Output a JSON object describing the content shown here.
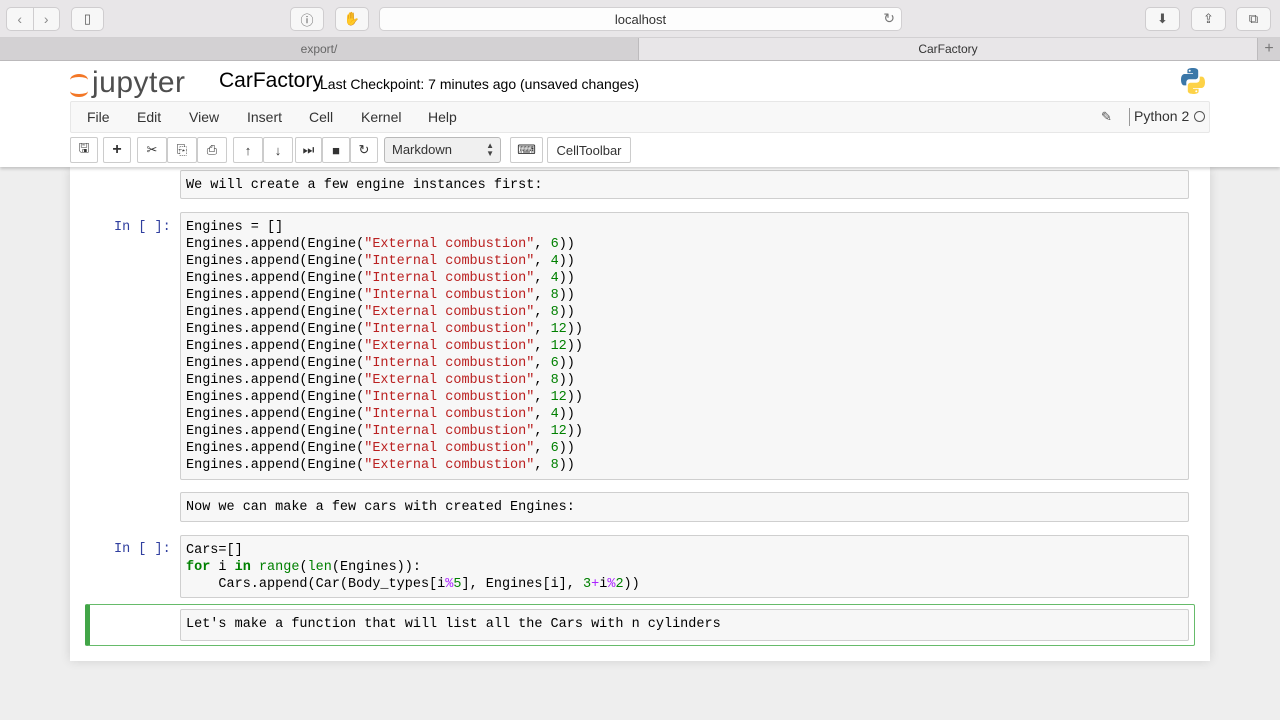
{
  "browser": {
    "url": "localhost",
    "tabs": [
      "export/",
      "CarFactory"
    ],
    "new_tab_label": "+"
  },
  "jupyter": {
    "logo_text": "jupyter",
    "notebook_name": "CarFactory",
    "checkpoint": "Last Checkpoint: 7 minutes ago (unsaved changes)",
    "menu": [
      "File",
      "Edit",
      "View",
      "Insert",
      "Cell",
      "Kernel",
      "Help"
    ],
    "kernel": "Python 2",
    "cell_type": "Markdown",
    "celltoolbar_label": "CellToolbar"
  },
  "cells": {
    "md1": "We will create a few engine instances first:",
    "prompt1": "In [ ]:",
    "engines_init": "Engines = []",
    "engine_calls": [
      {
        "type": "\"External combustion\"",
        "cyl": "6"
      },
      {
        "type": "\"Internal combustion\"",
        "cyl": "4"
      },
      {
        "type": "\"Internal combustion\"",
        "cyl": "4"
      },
      {
        "type": "\"Internal combustion\"",
        "cyl": "8"
      },
      {
        "type": "\"External combustion\"",
        "cyl": "8"
      },
      {
        "type": "\"Internal combustion\"",
        "cyl": "12"
      },
      {
        "type": "\"External combustion\"",
        "cyl": "12"
      },
      {
        "type": "\"Internal combustion\"",
        "cyl": "6"
      },
      {
        "type": "\"External combustion\"",
        "cyl": "8"
      },
      {
        "type": "\"Internal combustion\"",
        "cyl": "12"
      },
      {
        "type": "\"Internal combustion\"",
        "cyl": "4"
      },
      {
        "type": "\"Internal combustion\"",
        "cyl": "12"
      },
      {
        "type": "\"External combustion\"",
        "cyl": "6"
      },
      {
        "type": "\"External combustion\"",
        "cyl": "8"
      }
    ],
    "md2": "Now we can make a few cars with created Engines:",
    "prompt2": "In [ ]:",
    "md3": "Let's make a function that will list all the Cars with n cylinders"
  }
}
